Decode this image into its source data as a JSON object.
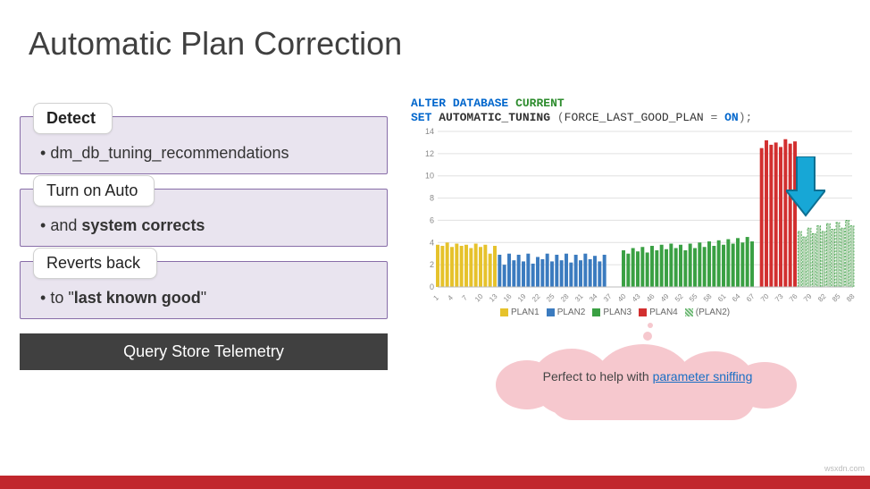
{
  "title": "Automatic Plan Correction",
  "cards": [
    {
      "header": "Detect",
      "header_bold": true,
      "body_prefix": "dm_db_tuning_recommendations",
      "body_bold": ""
    },
    {
      "header": "Turn on Auto",
      "header_bold": false,
      "body_prefix": "and ",
      "body_bold": "system corrects"
    },
    {
      "header": "Reverts back",
      "header_bold": false,
      "body_prefix": "to \"",
      "body_bold": "last known good",
      "body_suffix": "\""
    }
  ],
  "query_store_label": "Query Store Telemetry",
  "code": {
    "line1_kw1": "ALTER",
    "line1_kw2": "DATABASE",
    "line1_kw3": "CURRENT",
    "line2_kw1": "SET",
    "line2_id": "AUTOMATIC_TUNING",
    "line2_paren_open": "(",
    "line2_opt": "FORCE_LAST_GOOD_PLAN",
    "line2_eq": " = ",
    "line2_on": "ON",
    "line2_paren_close": ");"
  },
  "cloud": {
    "prefix": "Perfect to help with ",
    "link": "parameter sniffing"
  },
  "watermark": "wsxdn.com",
  "chart_data": {
    "type": "bar",
    "title": "",
    "xlabel": "",
    "ylabel": "",
    "ylim": [
      0,
      14
    ],
    "yticks": [
      0,
      2,
      4,
      6,
      8,
      10,
      12,
      14
    ],
    "x": [
      1,
      4,
      7,
      10,
      13,
      16,
      19,
      22,
      25,
      28,
      31,
      34,
      37,
      40,
      43,
      46,
      49,
      52,
      55,
      58,
      61,
      64,
      67,
      70,
      73,
      76,
      79,
      82,
      85,
      88
    ],
    "colors": {
      "PLAN1": "#e6c22b",
      "PLAN2": "#3b7bbf",
      "PLAN3": "#3aa043",
      "PLAN4": "#d22f2f",
      "(PLAN2)": "#7fb77e"
    },
    "legend": [
      "PLAN1",
      "PLAN2",
      "PLAN3",
      "PLAN4",
      "(PLAN2)"
    ],
    "bars": [
      {
        "x": 1,
        "y": 3.8,
        "s": "PLAN1"
      },
      {
        "x": 2,
        "y": 3.7,
        "s": "PLAN1"
      },
      {
        "x": 3,
        "y": 4.0,
        "s": "PLAN1"
      },
      {
        "x": 4,
        "y": 3.6,
        "s": "PLAN1"
      },
      {
        "x": 5,
        "y": 3.9,
        "s": "PLAN1"
      },
      {
        "x": 6,
        "y": 3.7,
        "s": "PLAN1"
      },
      {
        "x": 7,
        "y": 3.8,
        "s": "PLAN1"
      },
      {
        "x": 8,
        "y": 3.5,
        "s": "PLAN1"
      },
      {
        "x": 9,
        "y": 3.9,
        "s": "PLAN1"
      },
      {
        "x": 10,
        "y": 3.6,
        "s": "PLAN1"
      },
      {
        "x": 11,
        "y": 3.8,
        "s": "PLAN1"
      },
      {
        "x": 12,
        "y": 3.0,
        "s": "PLAN1"
      },
      {
        "x": 13,
        "y": 3.7,
        "s": "PLAN1"
      },
      {
        "x": 14,
        "y": 2.9,
        "s": "PLAN2"
      },
      {
        "x": 15,
        "y": 2.0,
        "s": "PLAN2"
      },
      {
        "x": 16,
        "y": 3.0,
        "s": "PLAN2"
      },
      {
        "x": 17,
        "y": 2.4,
        "s": "PLAN2"
      },
      {
        "x": 18,
        "y": 2.9,
        "s": "PLAN2"
      },
      {
        "x": 19,
        "y": 2.3,
        "s": "PLAN2"
      },
      {
        "x": 20,
        "y": 3.0,
        "s": "PLAN2"
      },
      {
        "x": 21,
        "y": 2.1,
        "s": "PLAN2"
      },
      {
        "x": 22,
        "y": 2.7,
        "s": "PLAN2"
      },
      {
        "x": 23,
        "y": 2.5,
        "s": "PLAN2"
      },
      {
        "x": 24,
        "y": 3.0,
        "s": "PLAN2"
      },
      {
        "x": 25,
        "y": 2.3,
        "s": "PLAN2"
      },
      {
        "x": 26,
        "y": 2.9,
        "s": "PLAN2"
      },
      {
        "x": 27,
        "y": 2.4,
        "s": "PLAN2"
      },
      {
        "x": 28,
        "y": 3.0,
        "s": "PLAN2"
      },
      {
        "x": 29,
        "y": 2.2,
        "s": "PLAN2"
      },
      {
        "x": 30,
        "y": 2.9,
        "s": "PLAN2"
      },
      {
        "x": 31,
        "y": 2.4,
        "s": "PLAN2"
      },
      {
        "x": 32,
        "y": 3.0,
        "s": "PLAN2"
      },
      {
        "x": 33,
        "y": 2.5,
        "s": "PLAN2"
      },
      {
        "x": 34,
        "y": 2.8,
        "s": "PLAN2"
      },
      {
        "x": 35,
        "y": 2.3,
        "s": "PLAN2"
      },
      {
        "x": 36,
        "y": 2.9,
        "s": "PLAN2"
      },
      {
        "x": 40,
        "y": 3.3,
        "s": "PLAN3"
      },
      {
        "x": 41,
        "y": 3.0,
        "s": "PLAN3"
      },
      {
        "x": 42,
        "y": 3.5,
        "s": "PLAN3"
      },
      {
        "x": 43,
        "y": 3.2,
        "s": "PLAN3"
      },
      {
        "x": 44,
        "y": 3.6,
        "s": "PLAN3"
      },
      {
        "x": 45,
        "y": 3.1,
        "s": "PLAN3"
      },
      {
        "x": 46,
        "y": 3.7,
        "s": "PLAN3"
      },
      {
        "x": 47,
        "y": 3.3,
        "s": "PLAN3"
      },
      {
        "x": 48,
        "y": 3.8,
        "s": "PLAN3"
      },
      {
        "x": 49,
        "y": 3.4,
        "s": "PLAN3"
      },
      {
        "x": 50,
        "y": 3.9,
        "s": "PLAN3"
      },
      {
        "x": 51,
        "y": 3.5,
        "s": "PLAN3"
      },
      {
        "x": 52,
        "y": 3.8,
        "s": "PLAN3"
      },
      {
        "x": 53,
        "y": 3.3,
        "s": "PLAN3"
      },
      {
        "x": 54,
        "y": 3.9,
        "s": "PLAN3"
      },
      {
        "x": 55,
        "y": 3.5,
        "s": "PLAN3"
      },
      {
        "x": 56,
        "y": 4.0,
        "s": "PLAN3"
      },
      {
        "x": 57,
        "y": 3.6,
        "s": "PLAN3"
      },
      {
        "x": 58,
        "y": 4.1,
        "s": "PLAN3"
      },
      {
        "x": 59,
        "y": 3.7,
        "s": "PLAN3"
      },
      {
        "x": 60,
        "y": 4.2,
        "s": "PLAN3"
      },
      {
        "x": 61,
        "y": 3.8,
        "s": "PLAN3"
      },
      {
        "x": 62,
        "y": 4.3,
        "s": "PLAN3"
      },
      {
        "x": 63,
        "y": 3.9,
        "s": "PLAN3"
      },
      {
        "x": 64,
        "y": 4.4,
        "s": "PLAN3"
      },
      {
        "x": 65,
        "y": 4.0,
        "s": "PLAN3"
      },
      {
        "x": 66,
        "y": 4.5,
        "s": "PLAN3"
      },
      {
        "x": 67,
        "y": 4.1,
        "s": "PLAN3"
      },
      {
        "x": 69,
        "y": 12.5,
        "s": "PLAN4"
      },
      {
        "x": 70,
        "y": 13.2,
        "s": "PLAN4"
      },
      {
        "x": 71,
        "y": 12.8,
        "s": "PLAN4"
      },
      {
        "x": 72,
        "y": 13.0,
        "s": "PLAN4"
      },
      {
        "x": 73,
        "y": 12.6,
        "s": "PLAN4"
      },
      {
        "x": 74,
        "y": 13.3,
        "s": "PLAN4"
      },
      {
        "x": 75,
        "y": 12.9,
        "s": "PLAN4"
      },
      {
        "x": 76,
        "y": 13.1,
        "s": "PLAN4"
      },
      {
        "x": 77,
        "y": 5.0,
        "s": "(PLAN2)"
      },
      {
        "x": 78,
        "y": 4.5,
        "s": "(PLAN2)"
      },
      {
        "x": 79,
        "y": 5.3,
        "s": "(PLAN2)"
      },
      {
        "x": 80,
        "y": 4.8,
        "s": "(PLAN2)"
      },
      {
        "x": 81,
        "y": 5.5,
        "s": "(PLAN2)"
      },
      {
        "x": 82,
        "y": 5.0,
        "s": "(PLAN2)"
      },
      {
        "x": 83,
        "y": 5.7,
        "s": "(PLAN2)"
      },
      {
        "x": 84,
        "y": 5.2,
        "s": "(PLAN2)"
      },
      {
        "x": 85,
        "y": 5.8,
        "s": "(PLAN2)"
      },
      {
        "x": 86,
        "y": 5.3,
        "s": "(PLAN2)"
      },
      {
        "x": 87,
        "y": 6.0,
        "s": "(PLAN2)"
      },
      {
        "x": 88,
        "y": 5.5,
        "s": "(PLAN2)"
      }
    ]
  }
}
